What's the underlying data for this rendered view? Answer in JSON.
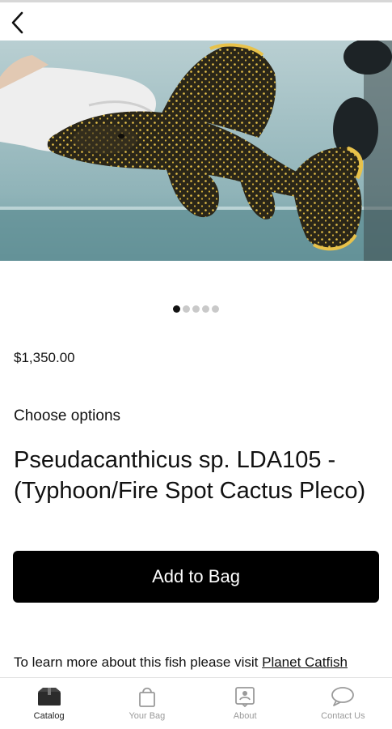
{
  "product": {
    "price": "$1,350.00",
    "options_label": "Choose options",
    "title": "Pseudacanthicus sp. LDA105 - (Typhoon/Fire Spot Cactus Pleco)",
    "add_to_bag_label": "Add to Bag",
    "info_text": "To learn more about this fish please visit ",
    "info_link": "Planet Catfish"
  },
  "gallery": {
    "image_count": 5,
    "active_index": 0
  },
  "tabs": [
    {
      "label": "Catalog",
      "icon": "catalog-icon",
      "active": true
    },
    {
      "label": "Your Bag",
      "icon": "bag-icon",
      "active": false
    },
    {
      "label": "About",
      "icon": "about-icon",
      "active": false
    },
    {
      "label": "Contact Us",
      "icon": "chat-icon",
      "active": false
    }
  ],
  "colors": {
    "button_bg": "#000000",
    "button_text": "#ffffff",
    "tab_active": "#222222",
    "tab_inactive": "#9a9a9a",
    "dot_active": "#111111",
    "dot_inactive": "#c9c9c9"
  }
}
